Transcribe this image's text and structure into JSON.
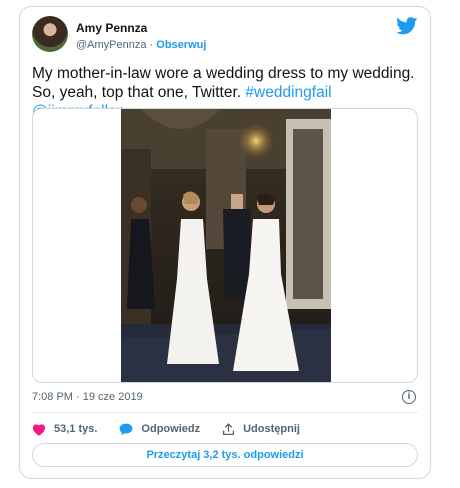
{
  "author": {
    "name": "Amy Pennza",
    "handle": "@AmyPennza",
    "separator": "·",
    "follow_label": "Obserwuj"
  },
  "tweet": {
    "text_plain": "My mother-in-law wore a wedding dress to my wedding. So, yeah, top that one, Twitter. ",
    "hashtag": "#weddingfail",
    "mention": "@jimmyfallon",
    "timestamp": "7:08 PM · 19 cze 2019"
  },
  "actions": {
    "likes": "53,1 tys.",
    "reply_label": "Odpowiedz",
    "share_label": "Udostępnij"
  },
  "read_replies_label": "Przeczytaj 3,2 tys. odpowiedzi",
  "icons": [
    "twitter-bird-icon",
    "heart-icon",
    "reply-bubble-icon",
    "share-icon",
    "info-icon"
  ],
  "colors": {
    "accent": "#1d9bf0",
    "like": "#f91880",
    "muted": "#536471"
  }
}
